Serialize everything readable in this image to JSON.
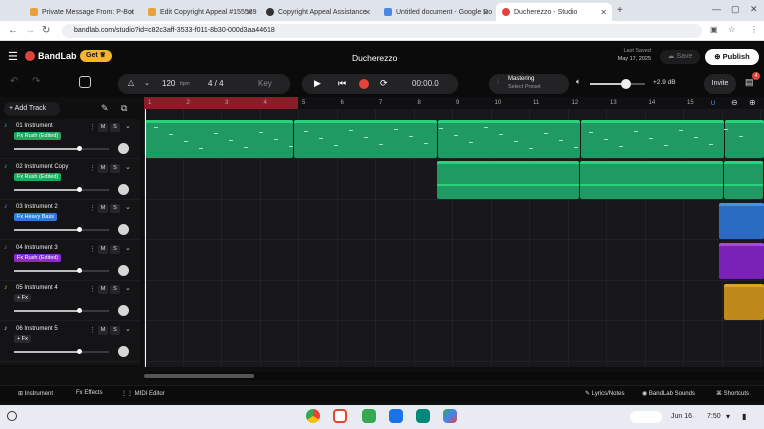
{
  "browser": {
    "tabs": [
      {
        "label": "Private Message From: P-Bot",
        "color": "#e8a23a"
      },
      {
        "label": "Edit Copyright Appeal #155589",
        "color": "#e8a23a"
      },
      {
        "label": "Copyright Appeal Assistance",
        "color": "#333333"
      },
      {
        "label": "Untitled document - Google Do",
        "color": "#4a86e8"
      },
      {
        "label": "Ducherezzo - Studio",
        "color": "#e0433a"
      }
    ],
    "url": "bandlab.com/studio?id=c82c3aff-3533-f011-8b30-000d3aa44618"
  },
  "header": {
    "logo": "BandLab",
    "get_label": "Get",
    "project_title": "Ducherezzo",
    "last_saved_label": "Last Saved",
    "last_saved_date": "May 17, 2025",
    "save_label": "Save",
    "publish_label": "Publish"
  },
  "toolbar": {
    "bpm": "120",
    "bpm_unit": "bpm",
    "time_sig": "4 / 4",
    "key_label": "Key",
    "time": "00:00.0",
    "mastering": "Mastering",
    "select_preset": "Select Preset",
    "db": "+2.9 dB",
    "invite": "Invite",
    "notif_count": "4"
  },
  "ruler": [
    "1",
    "2",
    "3",
    "4",
    "5",
    "6",
    "7",
    "8",
    "9",
    "10",
    "11",
    "12",
    "13",
    "14",
    "15"
  ],
  "add_track": "Add Track",
  "tracks": [
    {
      "name": "01  Instrument",
      "fx": "Fx Rush (Edited)",
      "fxcolor": "#1fa860",
      "icon_color": "#2dd07a",
      "level": 0.68
    },
    {
      "name": "02  Instrument Copy",
      "fx": "Fx Rush (Edited)",
      "fxcolor": "#1fa860",
      "icon_color": "#2dd07a",
      "level": 0.68
    },
    {
      "name": "03  Instrument 2",
      "fx": "Fx Heavy Bass",
      "fxcolor": "#2f7ad6",
      "icon_color": "#4a8ef0",
      "level": 0.68
    },
    {
      "name": "04  Instrument 3",
      "fx": "Fx Rush (Edited)",
      "fxcolor": "#8a2bd0",
      "icon_color": "#a54ae8",
      "level": 0.68
    },
    {
      "name": "05  Instrument 4",
      "fx": "+ Fx",
      "fxcolor": "#2a2a2e",
      "icon_color": "#e0a32a",
      "level": 0.68
    },
    {
      "name": "06  Instrument 5",
      "fx": "+ Fx",
      "fxcolor": "#2a2a2e",
      "icon_color": "#d0d0d0",
      "level": 0.68
    }
  ],
  "bottom": {
    "instrument": "Instrument",
    "effects": "Effects",
    "midi": "MIDI Editor",
    "lyrics": "Lyrics/Notes",
    "sounds": "BandLab Sounds",
    "shortcuts": "Shortcuts"
  },
  "shelf": {
    "date": "Jun 16",
    "time": "7:50"
  }
}
